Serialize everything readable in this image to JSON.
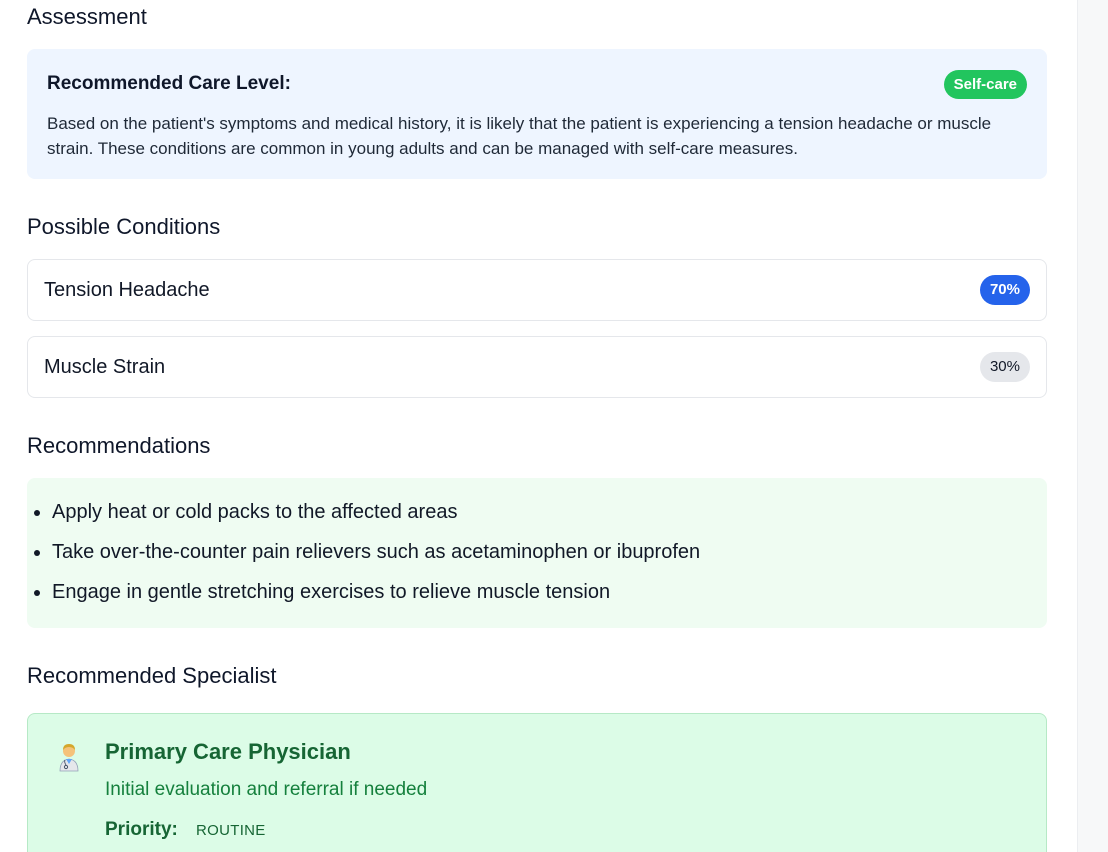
{
  "assessment": {
    "heading": "Assessment",
    "care_label": "Recommended Care Level:",
    "care_badge": "Self-care",
    "care_text": "Based on the patient's symptoms and medical history, it is likely that the patient is experiencing a tension headache or muscle strain. These conditions are common in young adults and can be managed with self-care measures."
  },
  "conditions": {
    "heading": "Possible Conditions",
    "items": [
      {
        "name": "Tension Headache",
        "probability": "70%"
      },
      {
        "name": "Muscle Strain",
        "probability": "30%"
      }
    ]
  },
  "recommendations": {
    "heading": "Recommendations",
    "items": [
      "Apply heat or cold packs to the affected areas",
      "Take over-the-counter pain relievers such as acetaminophen or ibuprofen",
      "Engage in gentle stretching exercises to relieve muscle tension"
    ]
  },
  "specialist": {
    "heading": "Recommended Specialist",
    "icon": "doctor-icon",
    "title": "Primary Care Physician",
    "description": "Initial evaluation and referral if needed",
    "priority_label": "Priority:",
    "priority_value": "ROUTINE"
  },
  "colors": {
    "badge_selfcare": "#22c55e",
    "badge_primary": "#2563eb",
    "specialist_bg": "#dcfce7",
    "care_bg": "#eef5ff",
    "rec_bg": "#effcf2"
  }
}
